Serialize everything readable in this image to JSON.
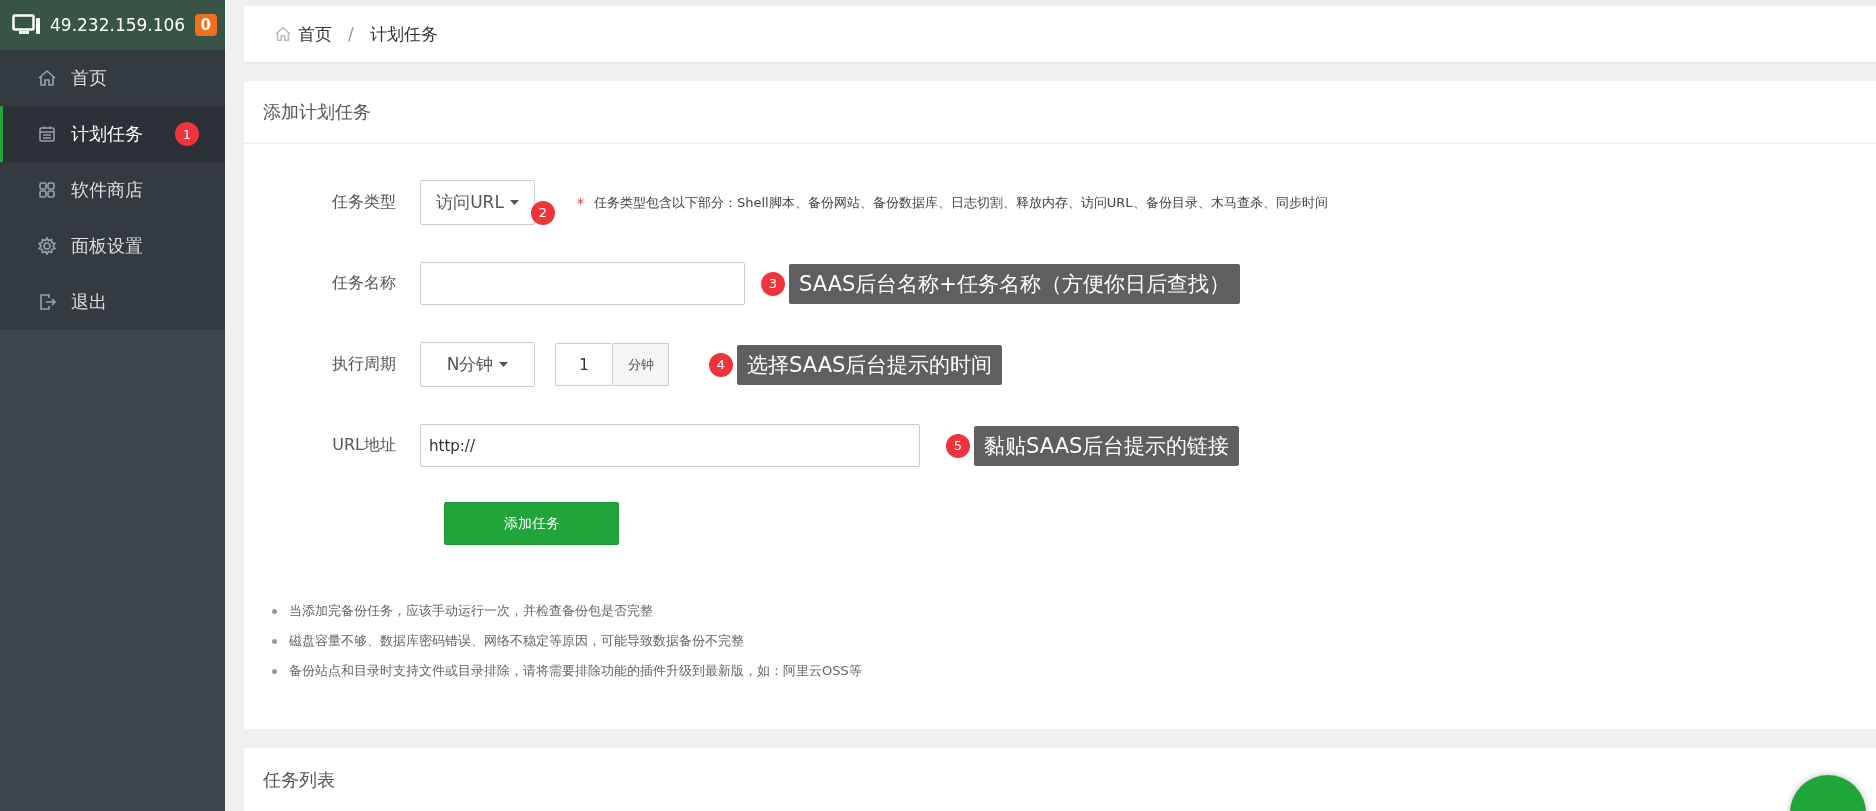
{
  "server": {
    "ip": "49.232.159.106",
    "alert_count": "0"
  },
  "menu": [
    {
      "label": "首页",
      "selected": false
    },
    {
      "label": "计划任务",
      "selected": true,
      "marker": "1"
    },
    {
      "label": "软件商店",
      "selected": false
    },
    {
      "label": "面板设置",
      "selected": false
    },
    {
      "label": "退出",
      "selected": false
    }
  ],
  "breadcrumb": [
    "首页",
    "计划任务"
  ],
  "breadcrumb_separator": "/",
  "add_panel": {
    "title": "添加计划任务",
    "fields": [
      {
        "kind": "select",
        "label": "任务类型",
        "value": "访问URL",
        "marker": "2",
        "required_mark": "*",
        "hint": "任务类型包含以下部分：Shell脚本、备份网站、备份数据库、日志切割、释放内存、访问URL、备份目录、木马查杀、同步时间"
      },
      {
        "kind": "text",
        "label": "任务名称",
        "marker": "3",
        "tooltip": "SAAS后台名称+任务名称（方便你日后查找）"
      },
      {
        "kind": "period",
        "label": "执行周期",
        "value": "N分钟",
        "number": "1",
        "unit": "分钟",
        "marker": "4",
        "tooltip": "选择SAAS后台提示的时间"
      },
      {
        "kind": "url",
        "label": "URL地址",
        "value": "http://",
        "marker": "5",
        "tooltip": "黏贴SAAS后台提示的链接"
      }
    ],
    "submit": "添加任务",
    "notes": [
      "当添加完备份任务，应该手动运行一次，并检查备份包是否完整",
      "磁盘容量不够、数据库密码错误、网络不稳定等原因，可能导致数据备份不完整",
      "备份站点和目录时支持文件或目录排除，请将需要排除功能的插件升级到最新版，如：阿里云OSS等"
    ]
  },
  "list_panel": {
    "title": "任务列表"
  }
}
